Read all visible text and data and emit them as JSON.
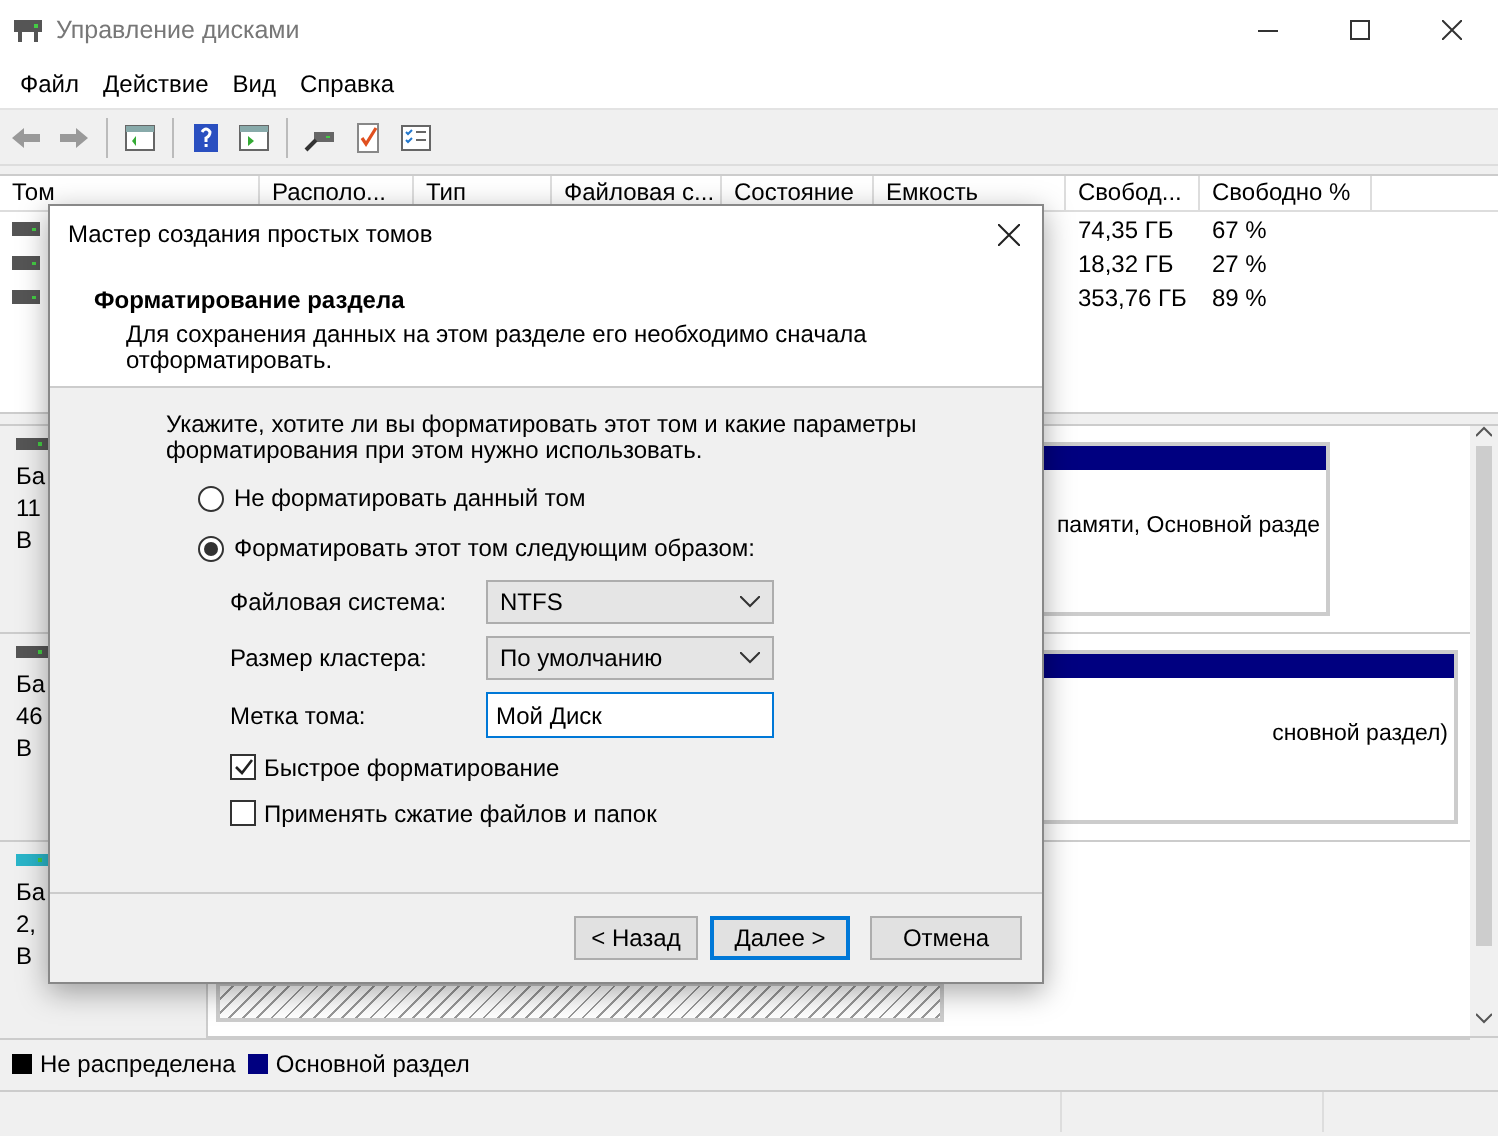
{
  "window": {
    "title": "Управление дисками"
  },
  "menu": [
    "Файл",
    "Действие",
    "Вид",
    "Справка"
  ],
  "table": {
    "columns": [
      "Том",
      "Располо...",
      "Тип",
      "Файловая с...",
      "Состояние",
      "Емкость",
      "Свобод...",
      "Свободно %"
    ],
    "rows": [
      {
        "free": "74,35 ГБ",
        "free_percent": "67 %"
      },
      {
        "free": "18,32 ГБ",
        "free_percent": "27 %"
      },
      {
        "free": "353,76 ГБ",
        "free_percent": "89 %"
      }
    ]
  },
  "disks": [
    {
      "kind": "fixed",
      "lines": [
        "Ба",
        "11",
        "В"
      ],
      "partition": {
        "kind": "primary",
        "text": "памяти, Основной разде"
      }
    },
    {
      "kind": "fixed",
      "lines": [
        "Ба",
        "46",
        "В"
      ],
      "partition": {
        "kind": "primary",
        "text": "сновной раздел)"
      }
    },
    {
      "kind": "removable",
      "lines": [
        "Ба",
        "2,",
        "В"
      ],
      "partition": {
        "kind": "unallocated"
      }
    }
  ],
  "legend": [
    {
      "label": "Не распределена",
      "color": "#000000"
    },
    {
      "label": "Основной раздел",
      "color": "#000080"
    }
  ],
  "dialog": {
    "title": "Мастер создания простых томов",
    "heading": "Форматирование раздела",
    "subtitle": "Для сохранения данных на этом разделе его необходимо сначала отформатировать.",
    "prompt": "Укажите, хотите ли вы форматировать этот том и какие параметры форматирования при этом нужно использовать.",
    "options": [
      {
        "label": "Не форматировать данный том",
        "selected": false
      },
      {
        "label": "Форматировать этот том следующим образом:",
        "selected": true
      }
    ],
    "fields": [
      {
        "kind": "select",
        "label": "Файловая система:",
        "value": "NTFS"
      },
      {
        "kind": "select",
        "label": "Размер кластера:",
        "value": "По умолчанию"
      },
      {
        "kind": "text",
        "label": "Метка тома:",
        "value": "Мой Диск"
      }
    ],
    "checkboxes": [
      {
        "label": "Быстрое форматирование",
        "checked": true
      },
      {
        "label": "Применять сжатие файлов и папок",
        "checked": false
      }
    ],
    "buttons": [
      {
        "label": "< Назад",
        "default": false
      },
      {
        "label": "Далее >",
        "default": true
      },
      {
        "label": "Отмена",
        "default": false
      }
    ]
  }
}
